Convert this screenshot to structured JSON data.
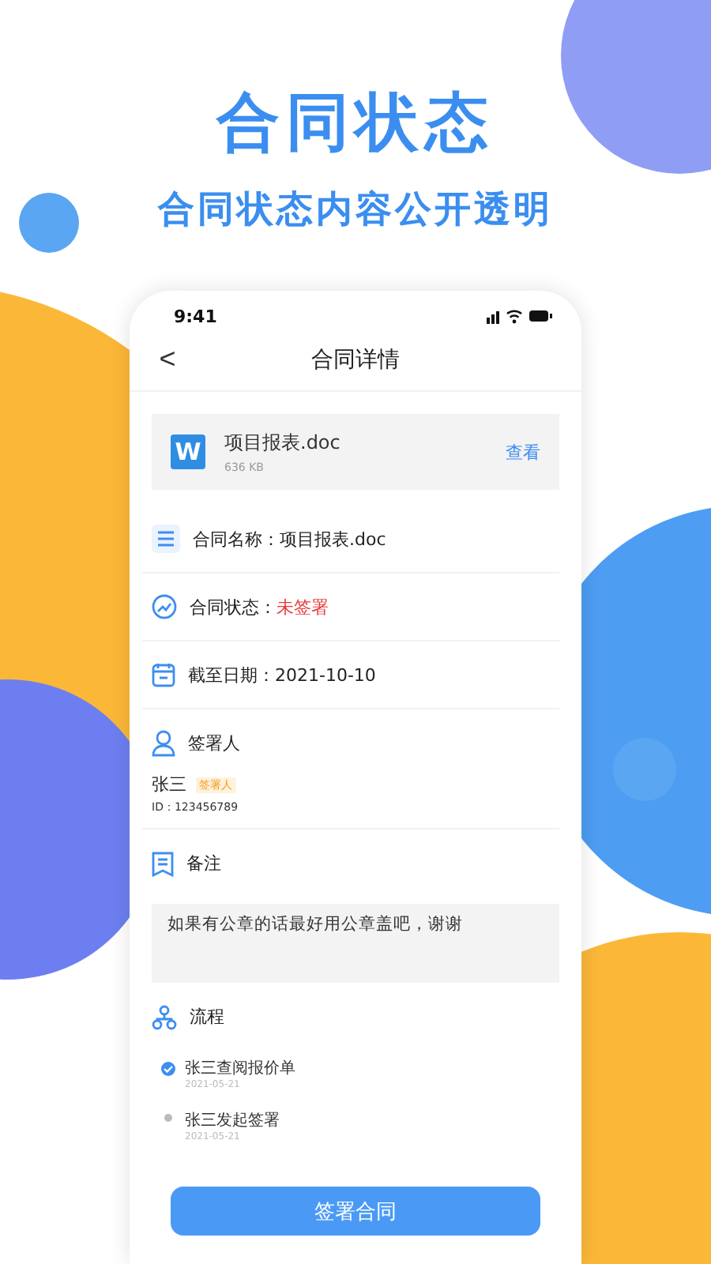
{
  "headline": "合同状态",
  "subtitle": "合同状态内容公开透明",
  "status_bar": {
    "time": "9:41"
  },
  "nav": {
    "back": "<",
    "title": "合同详情"
  },
  "file": {
    "badge": "W",
    "name": "项目报表.doc",
    "size": "636 KB",
    "action": "查看"
  },
  "fields": [
    {
      "kind": "list",
      "label": "合同名称：",
      "value": "项目报表.doc",
      "alert": false
    },
    {
      "kind": "trend",
      "label": "合同状态：",
      "value": "未签署",
      "alert": true
    },
    {
      "kind": "calendar",
      "label": "截至日期：",
      "value": "2021-10-10",
      "alert": false
    }
  ],
  "signer": {
    "title": "签署人",
    "name": "张三",
    "tag": "签署人",
    "id": "ID：123456789"
  },
  "remark": {
    "title": "备注",
    "text": "如果有公章的话最好用公章盖吧，谢谢"
  },
  "flow": {
    "title": "流程",
    "steps": [
      {
        "text": "张三查阅报价单",
        "date": "2021-05-21",
        "done": true
      },
      {
        "text": "张三发起签署",
        "date": "2021-05-21",
        "done": false
      }
    ]
  },
  "submit": "签署合同"
}
